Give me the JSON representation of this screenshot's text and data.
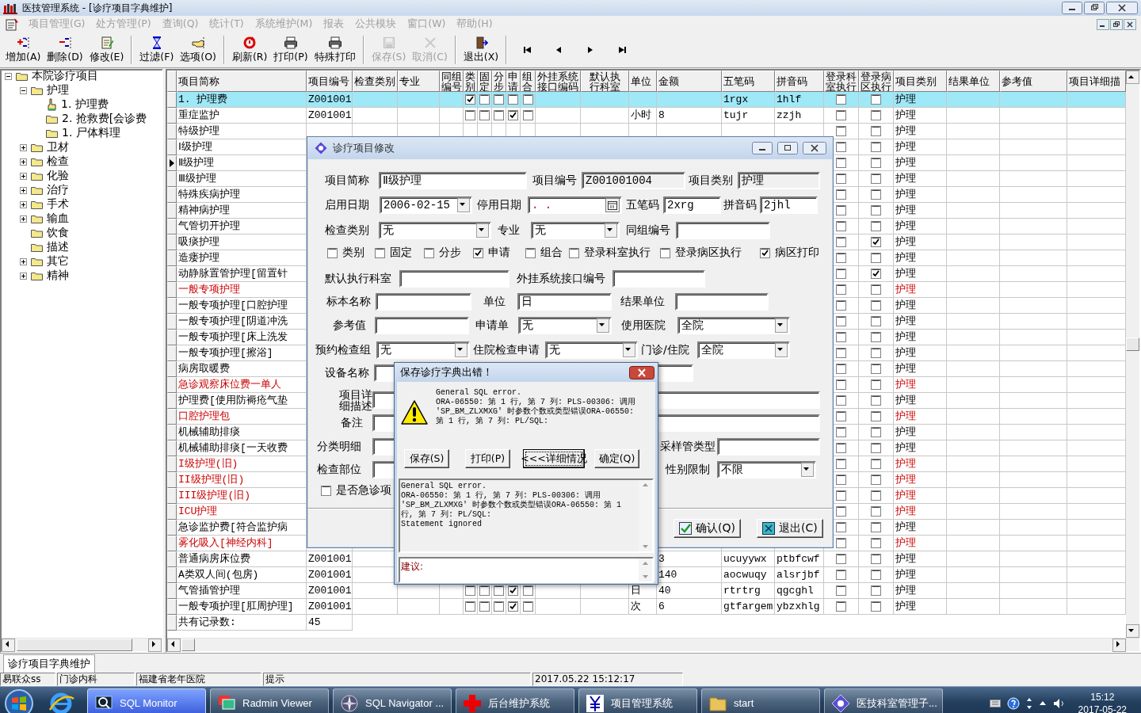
{
  "window": {
    "title": "医技管理系统 - [诊疗项目字典维护]"
  },
  "menu": [
    {
      "label": "项目管理(G)",
      "disabled": true
    },
    {
      "label": "处方管理(P)",
      "disabled": true
    },
    {
      "label": "查询(Q)",
      "disabled": true
    },
    {
      "label": "统计(T)",
      "disabled": true
    },
    {
      "label": "系统维护(M)",
      "disabled": true
    },
    {
      "label": "报表",
      "disabled": true
    },
    {
      "label": "公共模块",
      "disabled": true
    },
    {
      "label": "窗口(W)",
      "disabled": true
    },
    {
      "label": "帮助(H)",
      "disabled": true
    }
  ],
  "toolbar": [
    {
      "kind": "add",
      "label": "增加(A)",
      "disabled": false
    },
    {
      "kind": "delete",
      "label": "删除(D)",
      "disabled": false
    },
    {
      "kind": "edit",
      "label": "修改(E)",
      "disabled": false
    },
    {
      "kind": "separator"
    },
    {
      "kind": "filter",
      "label": "过滤(F)",
      "disabled": false
    },
    {
      "kind": "options",
      "label": "选项(O)",
      "disabled": false
    },
    {
      "kind": "separator"
    },
    {
      "kind": "refresh",
      "label": "刷新(R)",
      "disabled": false
    },
    {
      "kind": "print",
      "label": "打印(P)",
      "disabled": false
    },
    {
      "kind": "print",
      "label": "特殊打印",
      "disabled": false
    },
    {
      "kind": "separator"
    },
    {
      "kind": "save",
      "label": "保存(S)",
      "disabled": true
    },
    {
      "kind": "cancel",
      "label": "取消(C)",
      "disabled": true
    },
    {
      "kind": "separator"
    },
    {
      "kind": "exit",
      "label": "退出(X)",
      "disabled": false
    },
    {
      "kind": "separator"
    },
    {
      "kind": "first",
      "disabled": false
    },
    {
      "kind": "prev",
      "disabled": false
    },
    {
      "kind": "next",
      "disabled": false
    },
    {
      "kind": "last",
      "disabled": false
    }
  ],
  "tree": [
    {
      "label": "本院诊疗项目",
      "selected": false,
      "expanded": true,
      "children": [
        {
          "label": "护理",
          "selected": false,
          "expanded": true,
          "children": [
            {
              "label": "1. 护理费",
              "selected": true
            },
            {
              "label": "2. 抢救费[会诊费",
              "selected": false
            },
            {
              "label": "1. 尸体料理",
              "selected": false
            }
          ]
        },
        {
          "label": "卫材",
          "selected": false,
          "expanded": false
        },
        {
          "label": "检查",
          "selected": false,
          "expanded": false
        },
        {
          "label": "化验",
          "selected": false,
          "expanded": false
        },
        {
          "label": "治疗",
          "selected": false,
          "expanded": false
        },
        {
          "label": "手术",
          "selected": false,
          "expanded": false
        },
        {
          "label": "输血",
          "selected": false,
          "expanded": false
        },
        {
          "label": "饮食",
          "selected": false
        },
        {
          "label": "描述",
          "selected": false
        },
        {
          "label": "其它",
          "selected": false,
          "expanded": false
        },
        {
          "label": "精神",
          "selected": false,
          "expanded": false
        }
      ]
    }
  ],
  "table": {
    "columns": [
      "项目简称",
      "项目编号",
      "检查类别",
      "专业",
      "同组编号",
      "类别",
      "固定",
      "分步",
      "申请",
      "组合",
      "外挂系统接口编码",
      "默认执行科室",
      "单位",
      "金额",
      "五笔码",
      "拼音码",
      "登录科室执行",
      "登录病区执行",
      "项目类别",
      "结果单位",
      "参考值",
      "项目详细描"
    ],
    "rows": [
      {
        "name": "1. 护理费",
        "highlighted": false,
        "selected": true,
        "current": false,
        "code": "Z001001",
        "flags": [
          true,
          false,
          false,
          false,
          false
        ],
        "wubi": "1rgx",
        "pinyin": "1hlf",
        "dept_exec": false,
        "ward_exec": false,
        "category": "护理"
      },
      {
        "name": "重症监护",
        "highlighted": false,
        "selected": false,
        "current": false,
        "code": "Z001001",
        "flags": [
          false,
          false,
          false,
          true,
          false
        ],
        "unit": "小时",
        "price": "8",
        "wubi": "tujr",
        "pinyin": "zzjh",
        "dept_exec": false,
        "ward_exec": false,
        "category": "护理"
      },
      {
        "name": "特级护理",
        "highlighted": false,
        "selected": false,
        "current": false,
        "dept_exec": false,
        "ward_exec": false,
        "category": "护理"
      },
      {
        "name": "Ⅰ级护理",
        "highlighted": false,
        "selected": false,
        "current": false,
        "dept_exec": false,
        "ward_exec": false,
        "category": "护理"
      },
      {
        "name": "Ⅱ级护理",
        "highlighted": false,
        "selected": false,
        "current": true,
        "dept_exec": false,
        "ward_exec": false,
        "category": "护理"
      },
      {
        "name": "Ⅲ级护理",
        "highlighted": false,
        "selected": false,
        "current": false,
        "dept_exec": false,
        "ward_exec": false,
        "category": "护理"
      },
      {
        "name": "特殊疾病护理",
        "highlighted": false,
        "selected": false,
        "current": false,
        "dept_exec": false,
        "ward_exec": false,
        "category": "护理"
      },
      {
        "name": "精神病护理",
        "highlighted": false,
        "selected": false,
        "current": false,
        "dept_exec": false,
        "ward_exec": false,
        "category": "护理"
      },
      {
        "name": "气管切开护理",
        "highlighted": false,
        "selected": false,
        "current": false,
        "dept_exec": false,
        "ward_exec": false,
        "category": "护理"
      },
      {
        "name": "吸痰护理",
        "highlighted": false,
        "selected": false,
        "current": false,
        "dept_exec": false,
        "ward_exec": true,
        "category": "护理"
      },
      {
        "name": "造瘘护理",
        "highlighted": false,
        "selected": false,
        "current": false,
        "dept_exec": false,
        "ward_exec": false,
        "category": "护理"
      },
      {
        "name": "动静脉置管护理[留置针",
        "highlighted": false,
        "selected": false,
        "current": false,
        "dept_exec": false,
        "ward_exec": true,
        "category": "护理"
      },
      {
        "name": "一般专项护理",
        "highlighted": true,
        "selected": false,
        "current": false,
        "dept_exec": false,
        "ward_exec": false,
        "category": "护理"
      },
      {
        "name": "一般专项护理[口腔护理",
        "highlighted": false,
        "selected": false,
        "current": false,
        "dept_exec": false,
        "ward_exec": false,
        "category": "护理"
      },
      {
        "name": "一般专项护理[阴道冲洗",
        "highlighted": false,
        "selected": false,
        "current": false,
        "dept_exec": false,
        "ward_exec": false,
        "category": "护理"
      },
      {
        "name": "一般专项护理[床上洗发",
        "highlighted": false,
        "selected": false,
        "current": false,
        "dept_exec": false,
        "ward_exec": false,
        "category": "护理"
      },
      {
        "name": "一般专项护理[擦浴]",
        "highlighted": false,
        "selected": false,
        "current": false,
        "dept_exec": false,
        "ward_exec": false,
        "category": "护理"
      },
      {
        "name": "病房取暖费",
        "highlighted": false,
        "selected": false,
        "current": false,
        "dept_exec": false,
        "ward_exec": false,
        "category": "护理"
      },
      {
        "name": "急诊观察床位费一单人",
        "highlighted": true,
        "selected": false,
        "current": false,
        "dept_exec": false,
        "ward_exec": false,
        "category": "护理"
      },
      {
        "name": "护理费[使用防褥疮气垫",
        "highlighted": false,
        "selected": false,
        "current": false,
        "dept_exec": false,
        "ward_exec": false,
        "category": "护理"
      },
      {
        "name": "口腔护理包",
        "highlighted": true,
        "selected": false,
        "current": false,
        "dept_exec": false,
        "ward_exec": false,
        "category": "护理"
      },
      {
        "name": "机械辅助排痰",
        "highlighted": false,
        "selected": false,
        "current": false,
        "dept_exec": false,
        "ward_exec": false,
        "category": "护理"
      },
      {
        "name": "机械辅助排痰[一天收费",
        "highlighted": false,
        "selected": false,
        "current": false,
        "dept_exec": false,
        "ward_exec": false,
        "category": "护理"
      },
      {
        "name": "I级护理(旧)",
        "highlighted": true,
        "selected": false,
        "current": false,
        "dept_exec": false,
        "ward_exec": false,
        "category": "护理"
      },
      {
        "name": "II级护理(旧)",
        "highlighted": true,
        "selected": false,
        "current": false,
        "dept_exec": false,
        "ward_exec": false,
        "category": "护理"
      },
      {
        "name": "III级护理(旧)",
        "highlighted": true,
        "selected": false,
        "current": false,
        "dept_exec": false,
        "ward_exec": false,
        "category": "护理"
      },
      {
        "name": "ICU护理",
        "highlighted": true,
        "selected": false,
        "current": false,
        "dept_exec": false,
        "ward_exec": false,
        "category": "护理"
      },
      {
        "name": "急诊监护费[符合监护病",
        "highlighted": false,
        "selected": false,
        "current": false,
        "dept_exec": false,
        "ward_exec": false,
        "category": "护理"
      },
      {
        "name": "雾化吸入[神经内科]",
        "highlighted": true,
        "selected": false,
        "current": false,
        "dept_exec": false,
        "ward_exec": false,
        "category": "护理"
      },
      {
        "name": "普通病房床位费",
        "highlighted": false,
        "selected": false,
        "current": false,
        "code": "Z001001",
        "price": "3",
        "wubi": "ucuyywx",
        "pinyin": "ptbfcwf",
        "dept_exec": false,
        "ward_exec": false,
        "category": "护理"
      },
      {
        "name": "A类双人间(包房)",
        "highlighted": false,
        "selected": false,
        "current": false,
        "code": "Z001001",
        "price": "140",
        "wubi": "aocwuqy",
        "pinyin": "alsrjbf",
        "dept_exec": false,
        "ward_exec": false,
        "category": "护理"
      },
      {
        "name": "气管插管护理",
        "highlighted": false,
        "selected": false,
        "current": false,
        "code": "Z001001",
        "flags": [
          false,
          false,
          false,
          true,
          false
        ],
        "unit": "日",
        "price": "40",
        "wubi": "rtrtrg",
        "pinyin": "qgcghl",
        "dept_exec": false,
        "ward_exec": false,
        "category": "护理"
      },
      {
        "name": "一般专项护理[肛周护理]",
        "highlighted": false,
        "selected": false,
        "current": false,
        "code": "Z001001",
        "flags": [
          false,
          false,
          false,
          true,
          false
        ],
        "unit": "次",
        "price": "6",
        "wubi": "gtfargem",
        "pinyin": "ybzxhlg",
        "dept_exec": false,
        "ward_exec": false,
        "category": "护理"
      }
    ],
    "total": {
      "label": "共有记录数:",
      "value": "45"
    }
  },
  "edit_dialog": {
    "title": "诊疗项目修改",
    "rows": [
      [
        {
          "kind": "text",
          "label": "项目简称",
          "value": "Ⅱ级护理"
        },
        {
          "kind": "readonly",
          "label": "项目编号",
          "value": "Z001001004"
        },
        {
          "kind": "readonly",
          "label": "项目类别",
          "value": "护理"
        }
      ],
      [
        {
          "kind": "combo",
          "label": "启用日期",
          "value": "2006-02-15"
        },
        {
          "kind": "date",
          "label": "停用日期",
          "value": ".  ."
        },
        {
          "kind": "text",
          "label": "五笔码",
          "value": "2xrg"
        },
        {
          "kind": "text",
          "label": "拼音码",
          "value": "2jhl"
        }
      ],
      [
        {
          "kind": "combo",
          "label": "检查类别",
          "value": "无"
        },
        {
          "kind": "combo",
          "label": "专业",
          "value": "无"
        },
        {
          "kind": "text",
          "label": "同组编号"
        }
      ],
      [
        {
          "kind": "check",
          "label": "类别",
          "checked": false
        },
        {
          "kind": "check",
          "label": "固定",
          "checked": false
        },
        {
          "kind": "check",
          "label": "分步",
          "checked": false
        },
        {
          "kind": "check",
          "label": "申请",
          "checked": true
        },
        {
          "kind": "check",
          "label": "组合",
          "checked": false
        },
        {
          "kind": "check",
          "label": "登录科室执行",
          "checked": false
        },
        {
          "kind": "check",
          "label": "登录病区执行",
          "checked": false
        },
        {
          "kind": "check",
          "label": "病区打印",
          "checked": true
        }
      ],
      [
        {
          "kind": "text",
          "label": "默认执行科室"
        },
        {
          "kind": "text",
          "label": "外挂系统接口编号"
        }
      ],
      [
        {
          "kind": "text",
          "label": "标本名称"
        },
        {
          "kind": "text",
          "label": "单位",
          "value": "日"
        },
        {
          "kind": "text",
          "label": "结果单位"
        }
      ],
      [
        {
          "kind": "text",
          "label": "参考值"
        },
        {
          "kind": "combo",
          "label": "申请单",
          "value": "无"
        },
        {
          "kind": "combo",
          "label": "使用医院",
          "value": "全院"
        }
      ],
      [
        {
          "kind": "combo",
          "label": "预约检查组",
          "value": "无"
        },
        {
          "kind": "combo",
          "label": "住院检查申请",
          "value": "无"
        },
        {
          "kind": "combo",
          "label": "门诊/住院",
          "value": "全院"
        }
      ],
      [
        {
          "kind": "text",
          "label": "设备名称"
        }
      ],
      [
        {
          "kind": "text",
          "label": "项目详细描述"
        }
      ],
      [
        {
          "kind": "text",
          "label": "备注"
        }
      ],
      [
        {
          "kind": "text",
          "label": "分类明细"
        },
        {
          "kind": "text",
          "label": "采样管类型"
        }
      ],
      [
        {
          "kind": "text",
          "label": "检查部位"
        },
        {
          "kind": "combo",
          "label": "性别限制",
          "value": "不限"
        }
      ],
      [
        {
          "kind": "check",
          "label": "是否急诊项",
          "checked": false
        }
      ]
    ],
    "buttons": [
      {
        "kind": "ok",
        "label": "确认(Q)"
      },
      {
        "kind": "exit",
        "label": "退出(C)"
      }
    ]
  },
  "error_dialog": {
    "title": "保存诊疗字典出错！",
    "message": "General SQL error.\nORA-06550: 第 1 行, 第 7 列: PLS-00306: 调用\n'SP_BM_ZLXMXG' 时参数个数或类型错误ORA-06550:\n第 1 行, 第 7 列: PL/SQL:",
    "buttons": [
      {
        "label": "保存(S)",
        "focused": false
      },
      {
        "label": "打印(P)",
        "focused": false
      },
      {
        "label": "<<<详细情况",
        "focused": true
      },
      {
        "label": "确定(Q)",
        "focused": false
      }
    ],
    "details": "General SQL error.\nORA-06550: 第 1 行, 第 7 列: PLS-00306: 调用\n'SP_BM_ZLXMXG' 时参数个数或类型错误ORA-06550: 第 1\n行, 第 7 列: PL/SQL:\nStatement ignored",
    "suggestion_label": "建议:"
  },
  "doc_tabs": [
    {
      "label": "诊疗项目字典维护",
      "selected": true
    }
  ],
  "status_bar": [
    "易联众ss",
    "门诊内科",
    "福建省老年医院",
    "提示",
    "2017.05.22 15:12:17"
  ],
  "taskbar": {
    "items": [
      {
        "kind": "monitor",
        "label": "SQL Monitor",
        "selected": true
      },
      {
        "kind": "radmin",
        "label": "Radmin Viewer",
        "selected": false
      },
      {
        "kind": "compass",
        "label": "SQL Navigator ...",
        "selected": false
      },
      {
        "kind": "cross",
        "label": "后台维护系统",
        "selected": false
      },
      {
        "kind": "yuan",
        "label": "项目管理系统",
        "selected": false
      },
      {
        "kind": "folder",
        "label": "start",
        "selected": false
      },
      {
        "kind": "gem",
        "label": "医技科室管理子...",
        "selected": false
      }
    ],
    "clock": {
      "time": "15:12",
      "date": "2017-05-22"
    }
  }
}
